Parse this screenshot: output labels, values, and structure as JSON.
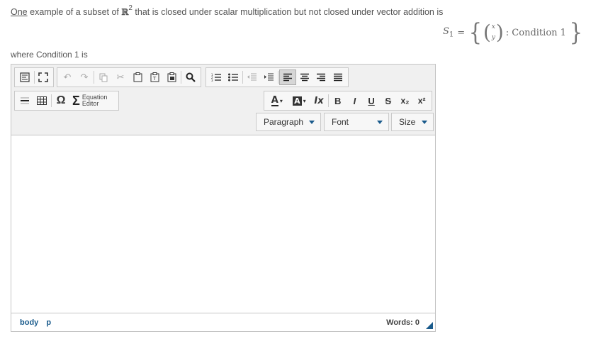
{
  "question": {
    "word_one": "One",
    "text_a": "example of a subset of",
    "set_symbol": "ℝ",
    "set_power": "2",
    "text_b": "that is closed under scalar multiplication but not closed under vector addition is"
  },
  "formula": {
    "set_name": "S",
    "set_index": "1",
    "equals": "=",
    "vec_top": "x",
    "vec_bottom": "y",
    "condition": ": Condition 1"
  },
  "where_text": "where Condition 1 is",
  "toolbar": {
    "equation_editor_line1": "Equation",
    "equation_editor_line2": "Editor",
    "text_color_label": "A",
    "bg_color_label": "A",
    "clear_format_label": "Ix",
    "bold_label": "B",
    "italic_label": "I",
    "underline_label": "U",
    "strike_label": "S",
    "subscript_label": "x₂",
    "superscript_label": "x²",
    "paragraph_select": "Paragraph",
    "font_select": "Font",
    "size_select": "Size"
  },
  "statusbar": {
    "path": [
      "body",
      "p"
    ],
    "words": "Words: 0"
  },
  "colors": {
    "accent": "#1a5b8c",
    "toolbar_bg": "#f0f0f0",
    "border": "#c5c5c5"
  }
}
